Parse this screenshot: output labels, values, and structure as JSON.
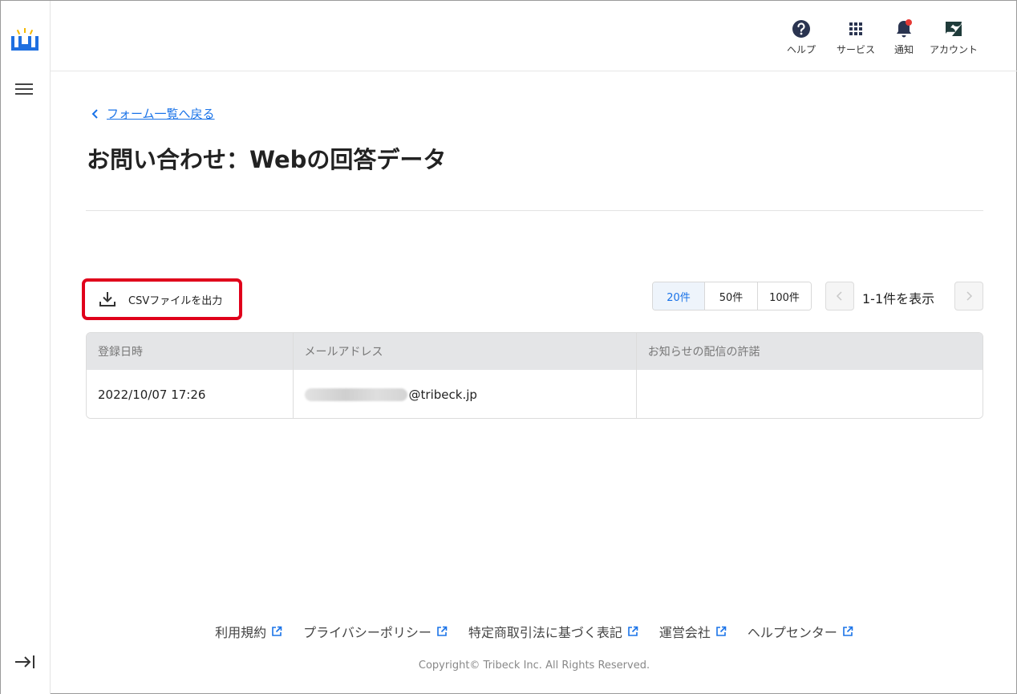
{
  "header": {
    "help_label": "ヘルプ",
    "services_label": "サービス",
    "notifications_label": "通知",
    "account_label": "アカウント"
  },
  "nav": {
    "back_label": "フォーム一覧へ戻る"
  },
  "page": {
    "title": "お問い合わせ：Webの回答データ"
  },
  "toolbar": {
    "csv_label": "CSVファイルを出力",
    "per_page_options": [
      "20件",
      "50件",
      "100件"
    ],
    "per_page_selected": "20件",
    "page_info": "1-1件を表示"
  },
  "table": {
    "columns": [
      "登録日時",
      "メールアドレス",
      "お知らせの配信の許諾"
    ],
    "rows": [
      {
        "registered_at": "2022/10/07 17:26",
        "email_domain": "@tribeck.jp",
        "consent": ""
      }
    ]
  },
  "footer": {
    "links": [
      "利用規約",
      "プライバシーポリシー",
      "特定商取引法に基づく表記",
      "運営会社",
      "ヘルプセンター"
    ],
    "copyright": "Copyright© Tribeck Inc. All Rights Reserved."
  },
  "colors": {
    "accent": "#1a73e8",
    "highlight_border": "#e0001b",
    "notification_dot": "#e53935"
  }
}
